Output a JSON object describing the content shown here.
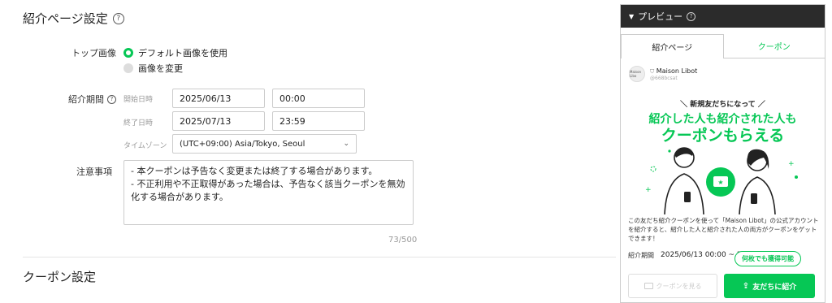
{
  "intro_settings": {
    "title": "紹介ページ設定",
    "top_image": {
      "label": "トップ画像",
      "option_default": "デフォルト画像を使用",
      "option_change": "画像を変更",
      "selected": "default"
    },
    "period": {
      "label": "紹介期間",
      "start_label": "開始日時",
      "start_date": "2025/06/13",
      "start_time": "00:00",
      "end_label": "終了日時",
      "end_date": "2025/07/13",
      "end_time": "23:59",
      "tz_label": "タイムゾーン",
      "tz_value": "(UTC+09:00) Asia/Tokyo, Seoul"
    },
    "notes": {
      "label": "注意事項",
      "value": "- 本クーポンは予告なく変更または終了する場合があります。\n- 不正利用や不正取得があった場合は、予告なく該当クーポンを無効化する場合があります。",
      "counter": "73/500"
    }
  },
  "coupon_settings": {
    "title": "クーポン設定"
  },
  "preview": {
    "header": "プレビュー",
    "tabs": [
      "紹介ページ",
      "クーポン"
    ],
    "active_tab": 0,
    "account_name": "Maison Libot",
    "account_handle": "@668bcsat",
    "avatar_text": "Maison Libo",
    "banner_small": "＼ 新規友だちになって ／",
    "banner_line1": "紹介した人も紹介された人も",
    "banner_line2": "クーポンもらえる",
    "description": "この友だち紹介クーポンを使って「Maison Libot」の公式アカウントを紹介すると、紹介した人と紹介された人の両方がクーポンをゲットできます！",
    "period_label": "紹介期間",
    "period_value": "2025/06/13 00:00 ~ 20",
    "bubble": "何枚でも獲得可能",
    "btn_coupon": "クーポンを見る",
    "btn_share": "友だちに紹介"
  },
  "colors": {
    "accent": "#06c755",
    "header_bg": "#2b2b2b"
  }
}
